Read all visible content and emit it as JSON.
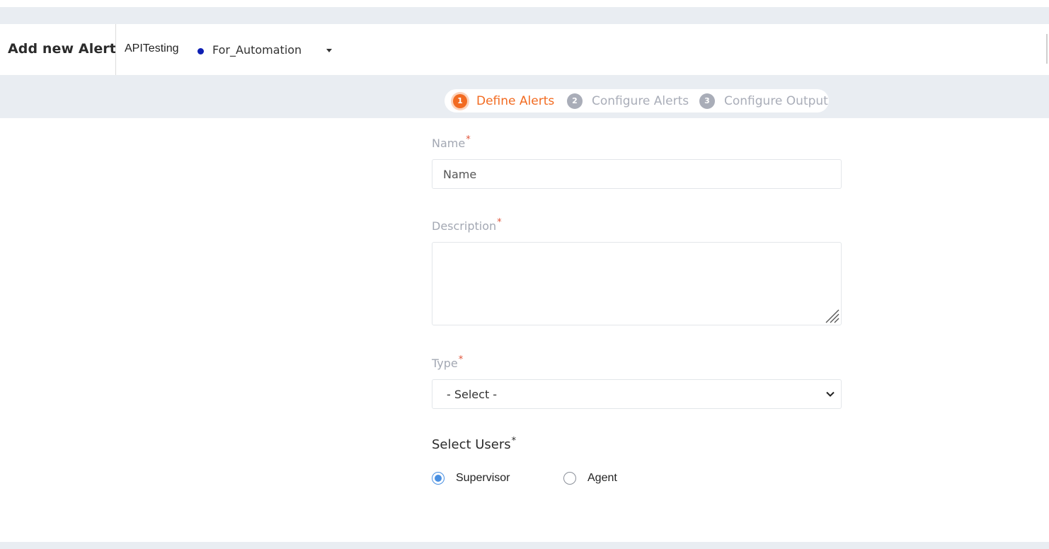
{
  "header": {
    "title": "Add new Alert",
    "project": "APITesting",
    "environment": "For_Automation",
    "environment_dot_color": "#0d1fb3"
  },
  "steps": [
    {
      "number": "1",
      "label": "Define Alerts",
      "active": true
    },
    {
      "number": "2",
      "label": "Configure Alerts",
      "active": false
    },
    {
      "number": "3",
      "label": "Configure Output",
      "active": false
    }
  ],
  "colors": {
    "accent": "#f26b21",
    "inactive_step": "#a9adb8",
    "radio_checked": "#4a90e2",
    "required_mark": "#e0553b"
  },
  "form": {
    "name": {
      "label": "Name",
      "required_mark": "*",
      "placeholder": "Name",
      "value": ""
    },
    "description": {
      "label": "Description",
      "required_mark": "*",
      "value": ""
    },
    "type": {
      "label": "Type",
      "required_mark": "*",
      "selected": "- Select -"
    },
    "select_users": {
      "label": "Select Users",
      "required_mark": "*",
      "options": [
        {
          "label": "Supervisor",
          "checked": true
        },
        {
          "label": "Agent",
          "checked": false
        }
      ]
    }
  }
}
